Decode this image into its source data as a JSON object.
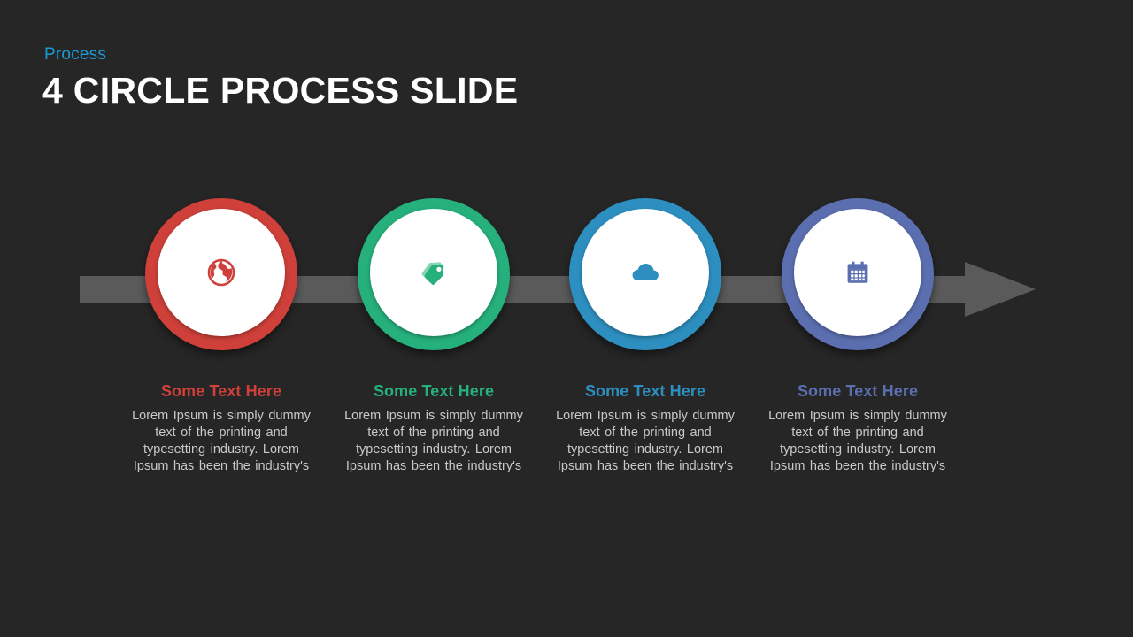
{
  "header": {
    "eyebrow": "Process",
    "title": "4 CIRCLE PROCESS SLIDE",
    "eyebrow_color": "#1b9ad6",
    "title_color": "#ffffff"
  },
  "background_color": "#262626",
  "arrow": {
    "name": "process-arrow",
    "color": "#5a5a5a",
    "direction": "right"
  },
  "steps": [
    {
      "index": 1,
      "icon": "globe-icon",
      "color": "#ce4039",
      "heading": "Some Text Here",
      "body": "Lorem Ipsum is simply dummy text of the printing and typesetting industry.  Lorem Ipsum has been the industry's"
    },
    {
      "index": 2,
      "icon": "tags-icon",
      "color": "#26b07c",
      "heading": "Some Text Here",
      "body": "Lorem Ipsum is simply dummy text of the printing and typesetting industry.  Lorem Ipsum has been the industry's"
    },
    {
      "index": 3,
      "icon": "cloud-icon",
      "color": "#2d8fc0",
      "heading": "Some Text Here",
      "body": "Lorem Ipsum is simply dummy text of the printing and typesetting industry.  Lorem Ipsum has been the industry's"
    },
    {
      "index": 4,
      "icon": "calendar-icon",
      "color": "#5b6fb0",
      "heading": "Some Text Here",
      "body": "Lorem Ipsum is simply dummy text of the printing and typesetting industry.  Lorem Ipsum has been the industry's"
    }
  ]
}
